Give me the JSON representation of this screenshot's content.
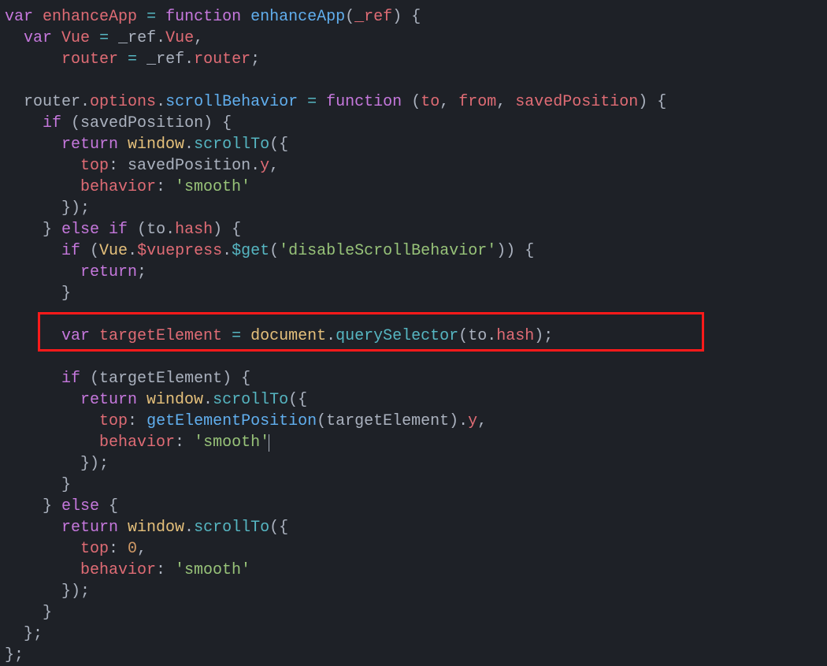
{
  "language": "javascript",
  "highlighted_line_index": 15,
  "lines": [
    {
      "indent": 0,
      "tokens": [
        {
          "t": "var ",
          "c": "kw"
        },
        {
          "t": "enhanceApp",
          "c": "id"
        },
        {
          "t": " ",
          "c": "punct"
        },
        {
          "t": "=",
          "c": "op"
        },
        {
          "t": " ",
          "c": "punct"
        },
        {
          "t": "function ",
          "c": "kw"
        },
        {
          "t": "enhanceApp",
          "c": "def"
        },
        {
          "t": "(",
          "c": "punct"
        },
        {
          "t": "_ref",
          "c": "param"
        },
        {
          "t": ") {",
          "c": "punct"
        }
      ]
    },
    {
      "indent": 1,
      "tokens": [
        {
          "t": "var ",
          "c": "kw"
        },
        {
          "t": "Vue",
          "c": "id"
        },
        {
          "t": " ",
          "c": "punct"
        },
        {
          "t": "=",
          "c": "op"
        },
        {
          "t": " ",
          "c": "punct"
        },
        {
          "t": "_ref",
          "c": "prop"
        },
        {
          "t": ".",
          "c": "punct"
        },
        {
          "t": "Vue",
          "c": "attr"
        },
        {
          "t": ",",
          "c": "punct"
        }
      ]
    },
    {
      "indent": 3,
      "tokens": [
        {
          "t": "router",
          "c": "id"
        },
        {
          "t": " ",
          "c": "punct"
        },
        {
          "t": "=",
          "c": "op"
        },
        {
          "t": " ",
          "c": "punct"
        },
        {
          "t": "_ref",
          "c": "prop"
        },
        {
          "t": ".",
          "c": "punct"
        },
        {
          "t": "router",
          "c": "attr"
        },
        {
          "t": ";",
          "c": "punct"
        }
      ]
    },
    {
      "indent": 0,
      "tokens": []
    },
    {
      "indent": 1,
      "tokens": [
        {
          "t": "router",
          "c": "prop"
        },
        {
          "t": ".",
          "c": "punct"
        },
        {
          "t": "options",
          "c": "attr"
        },
        {
          "t": ".",
          "c": "punct"
        },
        {
          "t": "scrollBehavior",
          "c": "def"
        },
        {
          "t": " ",
          "c": "punct"
        },
        {
          "t": "=",
          "c": "op"
        },
        {
          "t": " ",
          "c": "punct"
        },
        {
          "t": "function ",
          "c": "kw"
        },
        {
          "t": "(",
          "c": "punct"
        },
        {
          "t": "to",
          "c": "param"
        },
        {
          "t": ", ",
          "c": "punct"
        },
        {
          "t": "from",
          "c": "param"
        },
        {
          "t": ", ",
          "c": "punct"
        },
        {
          "t": "savedPosition",
          "c": "param"
        },
        {
          "t": ") {",
          "c": "punct"
        }
      ]
    },
    {
      "indent": 2,
      "tokens": [
        {
          "t": "if ",
          "c": "kw"
        },
        {
          "t": "(",
          "c": "punct"
        },
        {
          "t": "savedPosition",
          "c": "prop"
        },
        {
          "t": ") {",
          "c": "punct"
        }
      ]
    },
    {
      "indent": 3,
      "tokens": [
        {
          "t": "return ",
          "c": "kw"
        },
        {
          "t": "window",
          "c": "obj"
        },
        {
          "t": ".",
          "c": "punct"
        },
        {
          "t": "scrollTo",
          "c": "method"
        },
        {
          "t": "({",
          "c": "punct"
        }
      ]
    },
    {
      "indent": 4,
      "tokens": [
        {
          "t": "top",
          "c": "attr"
        },
        {
          "t": ": ",
          "c": "punct"
        },
        {
          "t": "savedPosition",
          "c": "prop"
        },
        {
          "t": ".",
          "c": "punct"
        },
        {
          "t": "y",
          "c": "attr"
        },
        {
          "t": ",",
          "c": "punct"
        }
      ]
    },
    {
      "indent": 4,
      "tokens": [
        {
          "t": "behavior",
          "c": "attr"
        },
        {
          "t": ": ",
          "c": "punct"
        },
        {
          "t": "'smooth'",
          "c": "str"
        }
      ]
    },
    {
      "indent": 3,
      "tokens": [
        {
          "t": "});",
          "c": "punct"
        }
      ]
    },
    {
      "indent": 2,
      "tokens": [
        {
          "t": "} ",
          "c": "punct"
        },
        {
          "t": "else if ",
          "c": "kw"
        },
        {
          "t": "(",
          "c": "punct"
        },
        {
          "t": "to",
          "c": "prop"
        },
        {
          "t": ".",
          "c": "punct"
        },
        {
          "t": "hash",
          "c": "attr"
        },
        {
          "t": ") {",
          "c": "punct"
        }
      ]
    },
    {
      "indent": 3,
      "tokens": [
        {
          "t": "if ",
          "c": "kw"
        },
        {
          "t": "(",
          "c": "punct"
        },
        {
          "t": "Vue",
          "c": "obj"
        },
        {
          "t": ".",
          "c": "punct"
        },
        {
          "t": "$vuepress",
          "c": "attr"
        },
        {
          "t": ".",
          "c": "punct"
        },
        {
          "t": "$get",
          "c": "method"
        },
        {
          "t": "(",
          "c": "punct"
        },
        {
          "t": "'disableScrollBehavior'",
          "c": "str"
        },
        {
          "t": ")) {",
          "c": "punct"
        }
      ]
    },
    {
      "indent": 4,
      "tokens": [
        {
          "t": "return",
          "c": "kw"
        },
        {
          "t": ";",
          "c": "punct"
        }
      ]
    },
    {
      "indent": 3,
      "tokens": [
        {
          "t": "}",
          "c": "punct"
        }
      ]
    },
    {
      "indent": 0,
      "tokens": []
    },
    {
      "indent": 3,
      "tokens": [
        {
          "t": "var ",
          "c": "kw"
        },
        {
          "t": "targetElement",
          "c": "id"
        },
        {
          "t": " ",
          "c": "punct"
        },
        {
          "t": "=",
          "c": "op"
        },
        {
          "t": " ",
          "c": "punct"
        },
        {
          "t": "document",
          "c": "obj"
        },
        {
          "t": ".",
          "c": "punct"
        },
        {
          "t": "querySelector",
          "c": "method"
        },
        {
          "t": "(",
          "c": "punct"
        },
        {
          "t": "to",
          "c": "prop"
        },
        {
          "t": ".",
          "c": "punct"
        },
        {
          "t": "hash",
          "c": "attr"
        },
        {
          "t": ");",
          "c": "punct"
        }
      ]
    },
    {
      "indent": 0,
      "tokens": []
    },
    {
      "indent": 3,
      "tokens": [
        {
          "t": "if ",
          "c": "kw"
        },
        {
          "t": "(",
          "c": "punct"
        },
        {
          "t": "targetElement",
          "c": "prop"
        },
        {
          "t": ") {",
          "c": "punct"
        }
      ]
    },
    {
      "indent": 4,
      "tokens": [
        {
          "t": "return ",
          "c": "kw"
        },
        {
          "t": "window",
          "c": "obj"
        },
        {
          "t": ".",
          "c": "punct"
        },
        {
          "t": "scrollTo",
          "c": "method"
        },
        {
          "t": "({",
          "c": "punct"
        }
      ]
    },
    {
      "indent": 5,
      "tokens": [
        {
          "t": "top",
          "c": "attr"
        },
        {
          "t": ": ",
          "c": "punct"
        },
        {
          "t": "getElementPosition",
          "c": "def"
        },
        {
          "t": "(",
          "c": "punct"
        },
        {
          "t": "targetElement",
          "c": "prop"
        },
        {
          "t": ").",
          "c": "punct"
        },
        {
          "t": "y",
          "c": "attr"
        },
        {
          "t": ",",
          "c": "punct"
        }
      ]
    },
    {
      "indent": 5,
      "tokens": [
        {
          "t": "behavior",
          "c": "attr"
        },
        {
          "t": ": ",
          "c": "punct"
        },
        {
          "t": "'smooth'",
          "c": "str"
        }
      ],
      "cursor_after": true
    },
    {
      "indent": 4,
      "tokens": [
        {
          "t": "});",
          "c": "punct"
        }
      ]
    },
    {
      "indent": 3,
      "tokens": [
        {
          "t": "}",
          "c": "punct"
        }
      ]
    },
    {
      "indent": 2,
      "tokens": [
        {
          "t": "} ",
          "c": "punct"
        },
        {
          "t": "else ",
          "c": "kw"
        },
        {
          "t": "{",
          "c": "punct"
        }
      ]
    },
    {
      "indent": 3,
      "tokens": [
        {
          "t": "return ",
          "c": "kw"
        },
        {
          "t": "window",
          "c": "obj"
        },
        {
          "t": ".",
          "c": "punct"
        },
        {
          "t": "scrollTo",
          "c": "method"
        },
        {
          "t": "({",
          "c": "punct"
        }
      ]
    },
    {
      "indent": 4,
      "tokens": [
        {
          "t": "top",
          "c": "attr"
        },
        {
          "t": ": ",
          "c": "punct"
        },
        {
          "t": "0",
          "c": "num"
        },
        {
          "t": ",",
          "c": "punct"
        }
      ]
    },
    {
      "indent": 4,
      "tokens": [
        {
          "t": "behavior",
          "c": "attr"
        },
        {
          "t": ": ",
          "c": "punct"
        },
        {
          "t": "'smooth'",
          "c": "str"
        }
      ]
    },
    {
      "indent": 3,
      "tokens": [
        {
          "t": "});",
          "c": "punct"
        }
      ]
    },
    {
      "indent": 2,
      "tokens": [
        {
          "t": "}",
          "c": "punct"
        }
      ]
    },
    {
      "indent": 1,
      "tokens": [
        {
          "t": "};",
          "c": "punct"
        }
      ]
    },
    {
      "indent": 0,
      "tokens": [
        {
          "t": "};",
          "c": "punct"
        }
      ]
    }
  ]
}
